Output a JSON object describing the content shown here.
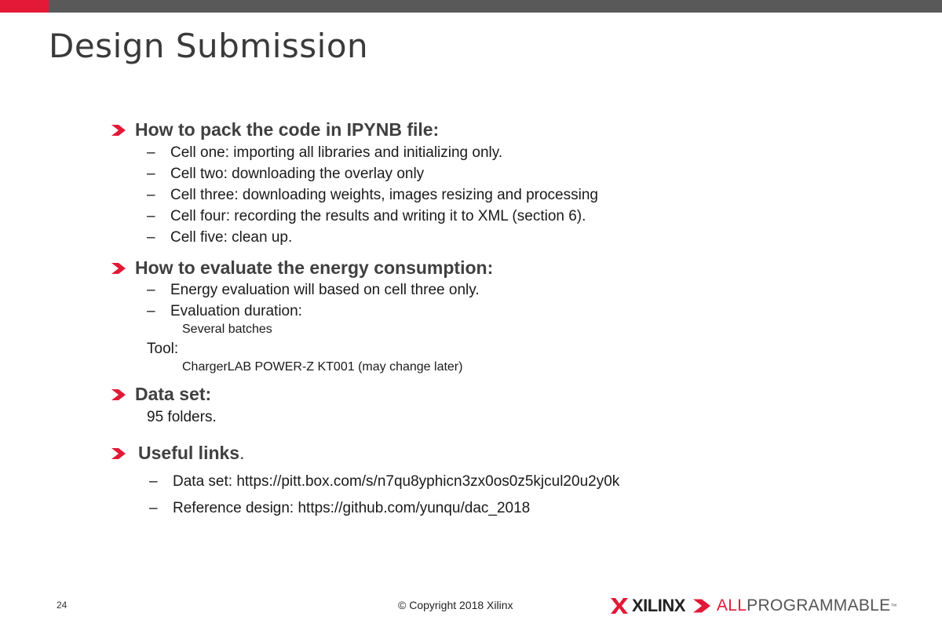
{
  "slide": {
    "title": "Design Submission",
    "page_number": "24",
    "copyright": "© Copyright 2018 Xilinx",
    "accent_color": "#e31937",
    "bar_color": "#595959"
  },
  "logo": {
    "brand": "XILINX",
    "tagline_red": "ALL",
    "tagline_gray": " PROGRAMMABLE",
    "trademark": "™"
  },
  "sections": {
    "pack": {
      "title": "How to pack the code in IPYNB file:",
      "items": [
        "Cell one: importing all libraries and initializing only.",
        "Cell two: downloading the overlay only",
        "Cell three: downloading weights, images resizing and processing",
        "Cell four: recording the results and writing it to XML (section 6).",
        "Cell five: clean up."
      ]
    },
    "energy": {
      "title": "How to evaluate the energy consumption:",
      "item_1": "Energy evaluation will based on cell three only.",
      "item_2": "Evaluation duration:",
      "item_2_detail": "Several batches",
      "tool_label": "Tool:",
      "tool_detail": "ChargerLAB POWER-Z KT001 (may change later)"
    },
    "dataset": {
      "title": "Data set:",
      "text": "95 folders."
    },
    "links": {
      "title": "Useful links",
      "title_suffix": ".",
      "items": [
        "Data set: https://pitt.box.com/s/n7qu8yphicn3zx0os0z5kjcul20u2y0k",
        "Reference design: https://github.com/yunqu/dac_2018"
      ]
    }
  },
  "icons": {
    "bullet": "red-chevron-icon",
    "dash": "–"
  }
}
